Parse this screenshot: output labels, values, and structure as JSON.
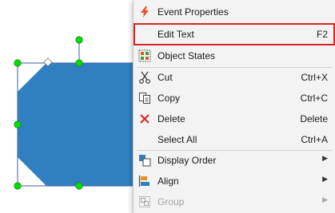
{
  "colors": {
    "shape_fill": "#2f7fc1",
    "handle": "#00e000",
    "highlight_border": "#d7262b",
    "menu_bg": "#f3f3f3"
  },
  "context_menu": {
    "items": [
      {
        "label": "Event Properties",
        "icon": "lightning-icon"
      },
      {
        "label": "Edit Text",
        "shortcut": "F2",
        "highlighted": true
      },
      {
        "label": "Object States",
        "icon": "object-states-icon"
      },
      {
        "label": "Cut",
        "shortcut": "Ctrl+X",
        "icon": "scissors-icon"
      },
      {
        "label": "Copy",
        "shortcut": "Ctrl+C",
        "icon": "copy-icon"
      },
      {
        "label": "Delete",
        "shortcut": "Delete",
        "icon": "delete-x-icon"
      },
      {
        "label": "Select All",
        "shortcut": "Ctrl+A"
      },
      {
        "label": "Display Order",
        "icon": "display-order-icon",
        "submenu": true
      },
      {
        "label": "Align",
        "icon": "align-icon",
        "submenu": true
      },
      {
        "label": "Group",
        "icon": "group-icon",
        "submenu": true,
        "disabled": true
      }
    ]
  }
}
